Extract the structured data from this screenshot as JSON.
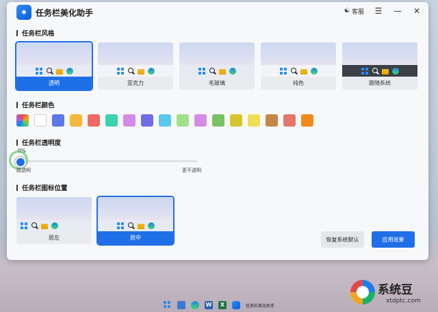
{
  "window": {
    "app_icon_text": "",
    "title": "任务栏美化助手",
    "help_label": "客服",
    "menu_icon": "menu-icon",
    "minimize_icon": "minimize-icon",
    "close_icon": "close-icon"
  },
  "sections": {
    "style": "任务栏风格",
    "color": "任务栏颜色",
    "transparency": "任务栏透明度",
    "icon_position": "任务栏图标位置"
  },
  "style_cards": [
    {
      "label": "透明",
      "bar": "glass",
      "selected": true
    },
    {
      "label": "亚克力",
      "bar": "light",
      "selected": false
    },
    {
      "label": "毛玻璃",
      "bar": "glass",
      "selected": false
    },
    {
      "label": "纯色",
      "bar": "light",
      "selected": false
    },
    {
      "label": "跟随系统",
      "bar": "dark",
      "selected": false
    }
  ],
  "swatch_colors": [
    "multicolor",
    "#ffffff",
    "#5b79e8",
    "#f5b83a",
    "#ee6b63",
    "#3ad3b0",
    "#d48ae8",
    "#6f6de6",
    "#5ac8ee",
    "#9fe08a",
    "#d58be8",
    "#79c262",
    "#d4c62b",
    "#f0dd57",
    "#c58748",
    "#e4766b",
    "#f08a1c"
  ],
  "transparency": {
    "value_label": "0%",
    "value": 0,
    "low_label": "超透明",
    "high_label": "更不透明"
  },
  "position_cards": [
    {
      "label": "居左",
      "selected": false
    },
    {
      "label": "居中",
      "selected": true
    }
  ],
  "buttons": {
    "reset": "恢复系统默认",
    "apply": "应用效果"
  },
  "taskbar": {
    "app_label": "任务栏美化助手"
  },
  "watermark": {
    "name": "系统豆",
    "url": "xtdptc.com"
  }
}
